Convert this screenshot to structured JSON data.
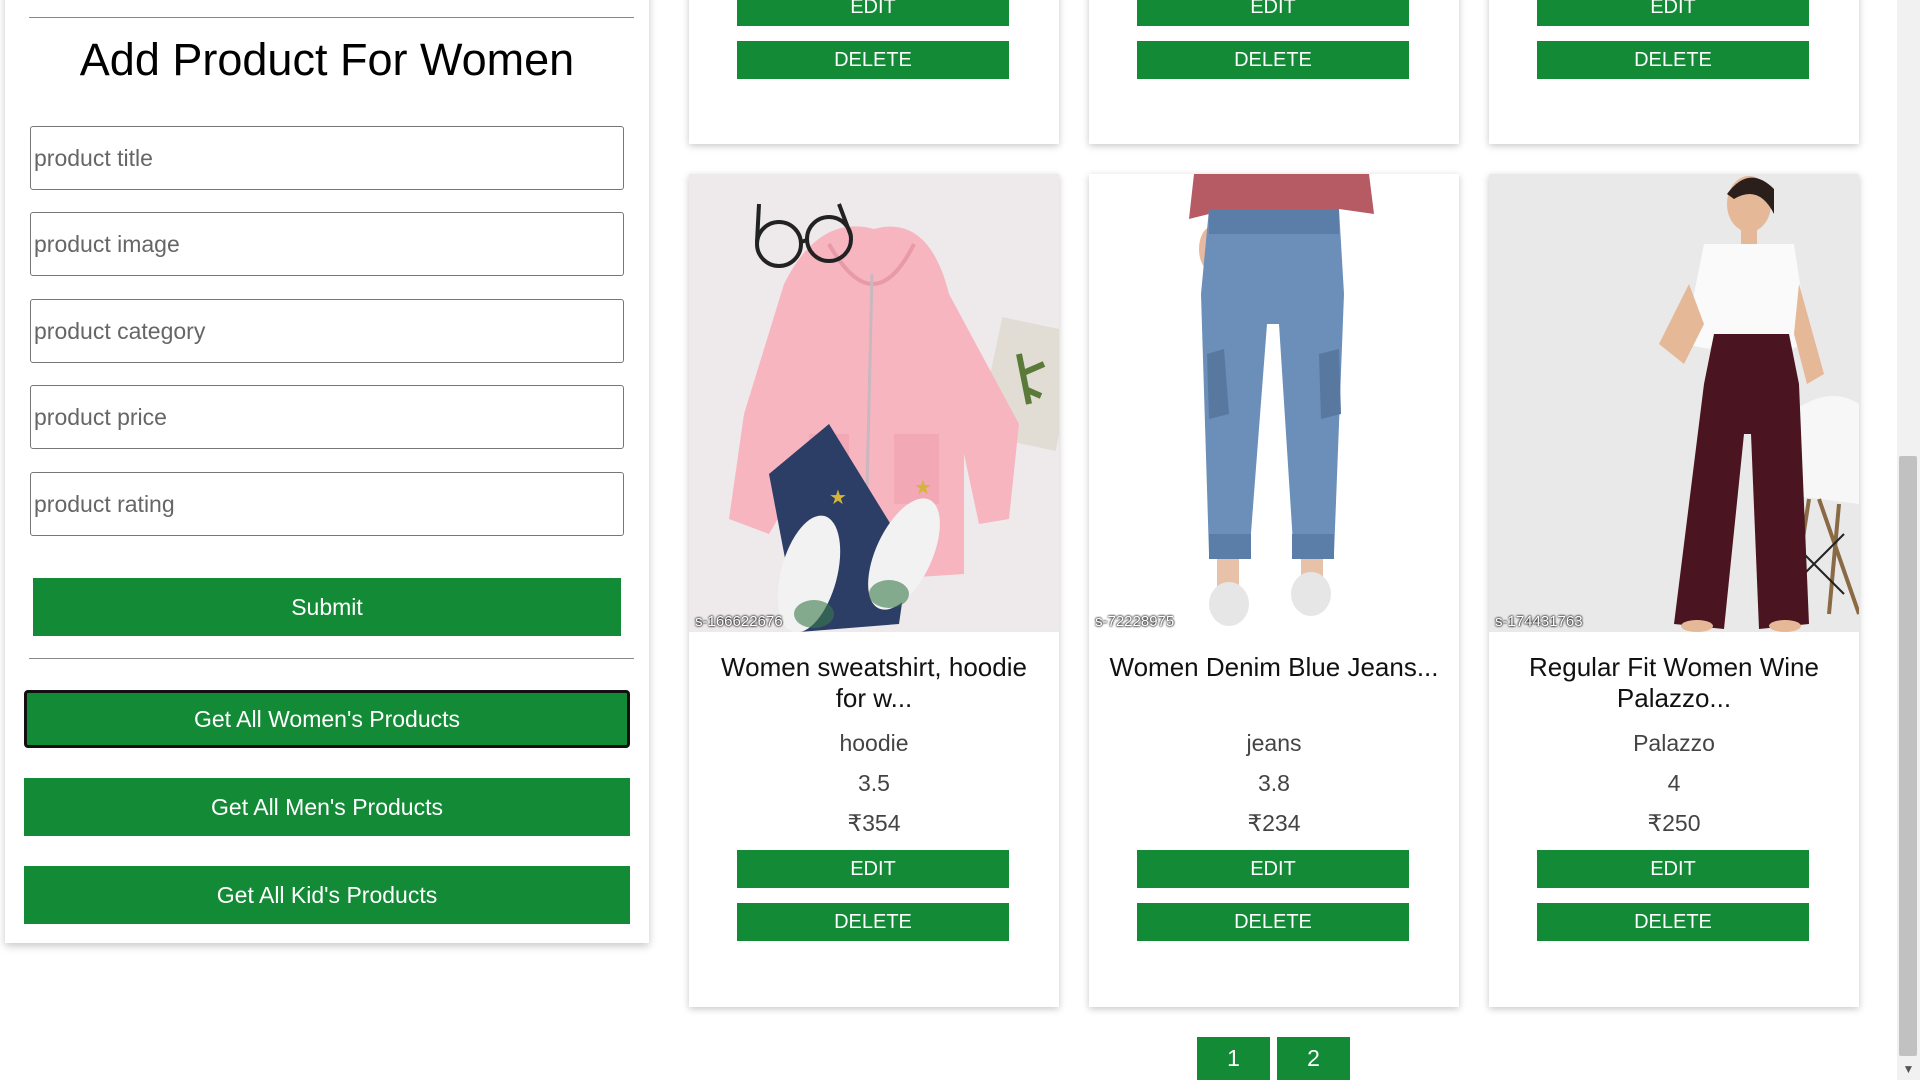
{
  "form": {
    "title": "Add Product For Women",
    "fields": {
      "title_placeholder": "product title",
      "image_placeholder": "product image",
      "category_placeholder": "product category",
      "price_placeholder": "product price",
      "rating_placeholder": "product rating"
    },
    "submit_label": "Submit"
  },
  "nav": {
    "women_label": "Get All Women's Products",
    "men_label": "Get All Men's Products",
    "kids_label": "Get All Kid's Products"
  },
  "card_actions": {
    "edit_label": "EDIT",
    "delete_label": "DELETE"
  },
  "products": [
    {
      "title": "Women sweatshirt, hoodie for w...",
      "category": "hoodie",
      "rating": "3.5",
      "price": "₹354",
      "watermark": "s-166622676"
    },
    {
      "title": "Women Denim Blue Jeans...",
      "category": "jeans",
      "rating": "3.8",
      "price": "₹234",
      "watermark": "s-72228975"
    },
    {
      "title": "Regular Fit Women Wine Palazzo...",
      "category": "Palazzo",
      "rating": "4",
      "price": "₹250",
      "watermark": "s-174431763"
    }
  ],
  "pagination": {
    "pages": [
      "1",
      "2"
    ]
  },
  "colors": {
    "accent": "#138a36",
    "active_border": "#111111"
  }
}
